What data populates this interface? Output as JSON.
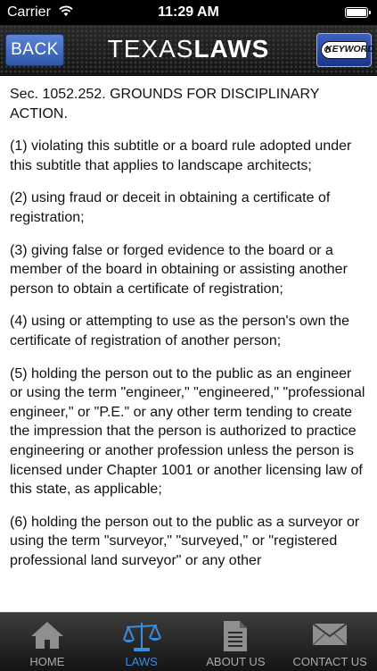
{
  "status_bar": {
    "carrier": "Carrier",
    "time": "11:29 AM"
  },
  "nav": {
    "back_label": "BACK",
    "brand_light": "TEXAS",
    "brand_bold": "LAWS",
    "keyword_label": "KEYWORD"
  },
  "content": {
    "heading": "Sec. 1052.252. GROUNDS FOR DISCIPLINARY ACTION.",
    "paragraphs": [
      "(1) violating this subtitle or a board rule adopted under this subtitle that applies to landscape architects;",
      "(2) using fraud or deceit in obtaining a certificate of registration;",
      "(3) giving false or forged evidence to the board or a member of the board in obtaining or assisting another person to obtain a certificate of registration;",
      "(4) using or attempting to use as the person's own the certificate of registration of another person;",
      "(5) holding the person out to the public as an engineer or using the term \"engineer,\" \"engineered,\" \"professional engineer,\" or \"P.E.\" or any other term tending to create the impression that the person is authorized to practice engineering or another profession unless the person is licensed under Chapter 1001 or another licensing law of this state, as applicable;",
      "(6) holding the person out to the public as a surveyor or using the term \"surveyor,\" \"surveyed,\" or \"registered professional land surveyor\" or any other"
    ]
  },
  "tabs": [
    {
      "label": "HOME",
      "icon": "home-icon"
    },
    {
      "label": "LAWS",
      "icon": "scales-icon"
    },
    {
      "label": "ABOUT US",
      "icon": "document-icon"
    },
    {
      "label": "CONTACT US",
      "icon": "envelope-icon"
    }
  ],
  "colors": {
    "accent": "#3b8ddf",
    "back_button": "#3f6cc2",
    "nav_background": "#1e1e1e"
  }
}
